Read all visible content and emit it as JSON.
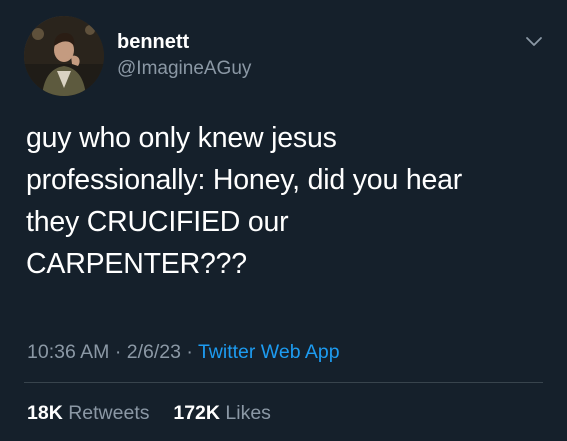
{
  "user": {
    "display_name": "bennett",
    "handle": "@ImagineAGuy",
    "avatar_icon": "profile-photo"
  },
  "tweet": {
    "lines": [
      "guy who only knew jesus",
      "professionally: Honey, did you hear",
      "they CRUCIFIED our",
      "CARPENTER???"
    ],
    "time": "10:36 AM",
    "date": "2/6/23",
    "separator": "·",
    "source": "Twitter Web App"
  },
  "stats": {
    "retweets_count": "18K",
    "retweets_label": "Retweets",
    "likes_count": "172K",
    "likes_label": "Likes"
  },
  "colors": {
    "background": "#15202b",
    "primary_text": "#ffffff",
    "secondary_text": "#8b98a5",
    "accent": "#1d9bf0",
    "divider": "#38444d"
  },
  "icons": {
    "menu": "chevron-down-icon"
  }
}
